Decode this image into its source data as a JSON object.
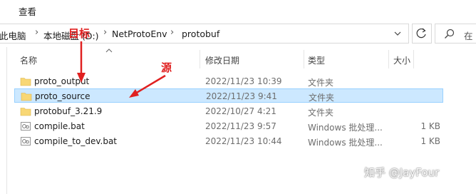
{
  "ribbon": {
    "view_tab": "查看"
  },
  "address": {
    "crumbs": [
      "此电脑",
      "本地磁盘 (D:)",
      "NetProtoEnv",
      "protobuf"
    ],
    "search_placeholder": "在"
  },
  "columns": {
    "name": "名称",
    "date": "修改日期",
    "type": "类型",
    "size": "大小"
  },
  "files": [
    {
      "name": "proto_output",
      "date": "2022/11/23 10:39",
      "type": "文件夹",
      "size": "",
      "icon": "folder-icon",
      "selected": false
    },
    {
      "name": "proto_source",
      "date": "2022/11/23 9:41",
      "type": "文件夹",
      "size": "",
      "icon": "folder-icon",
      "selected": true
    },
    {
      "name": "protobuf_3.21.9",
      "date": "2022/10/27 4:21",
      "type": "文件夹",
      "size": "",
      "icon": "folder-icon",
      "selected": false
    },
    {
      "name": "compile.bat",
      "date": "2022/11/23 9:57",
      "type": "Windows 批处理...",
      "size": "1 KB",
      "icon": "batch-file-icon",
      "selected": false
    },
    {
      "name": "compile_to_dev.bat",
      "date": "2022/11/23 10:44",
      "type": "Windows 批处理...",
      "size": "1 KB",
      "icon": "batch-file-icon",
      "selected": false
    }
  ],
  "annotations": {
    "target": "目标",
    "source": "源"
  },
  "watermark": "知乎 @JayFour",
  "colors": {
    "selection": "#cce8ff",
    "selection_border": "#99d1ff",
    "annotation": "#e02020",
    "folder": "#f8d775"
  }
}
